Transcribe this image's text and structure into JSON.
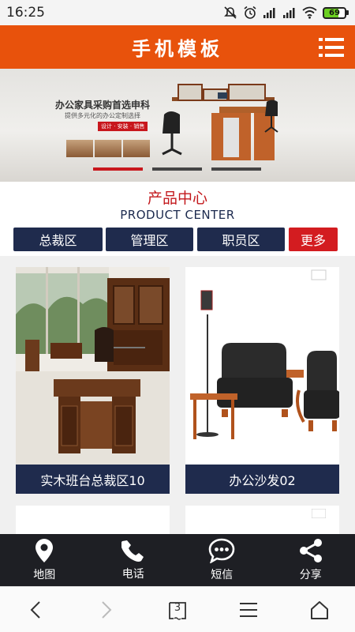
{
  "status_bar": {
    "time": "16:25",
    "battery": "69"
  },
  "header": {
    "title": "手机模板"
  },
  "banner": {
    "headline": "办公家具采购首选申科",
    "subline": "提供多元化的办公定制选择",
    "tags": "设计 · 安装 · 销售"
  },
  "section": {
    "title_cn": "产品中心",
    "title_en": "PRODUCT CENTER"
  },
  "tabs": [
    {
      "label": "总裁区"
    },
    {
      "label": "管理区"
    },
    {
      "label": "职员区"
    },
    {
      "label": "更多"
    }
  ],
  "products": [
    {
      "name": "实木班台总裁区10"
    },
    {
      "name": "办公沙发02"
    }
  ],
  "action_bar": [
    {
      "label": "地图",
      "icon": "map-pin-icon"
    },
    {
      "label": "电话",
      "icon": "phone-icon"
    },
    {
      "label": "短信",
      "icon": "message-icon"
    },
    {
      "label": "分享",
      "icon": "share-icon"
    }
  ],
  "browser_nav": {
    "tab_count": "3"
  },
  "colors": {
    "brand": "#e8520c",
    "navy": "#1f2b4d",
    "accent_red": "#d31c20",
    "section_red": "#c3181c"
  }
}
